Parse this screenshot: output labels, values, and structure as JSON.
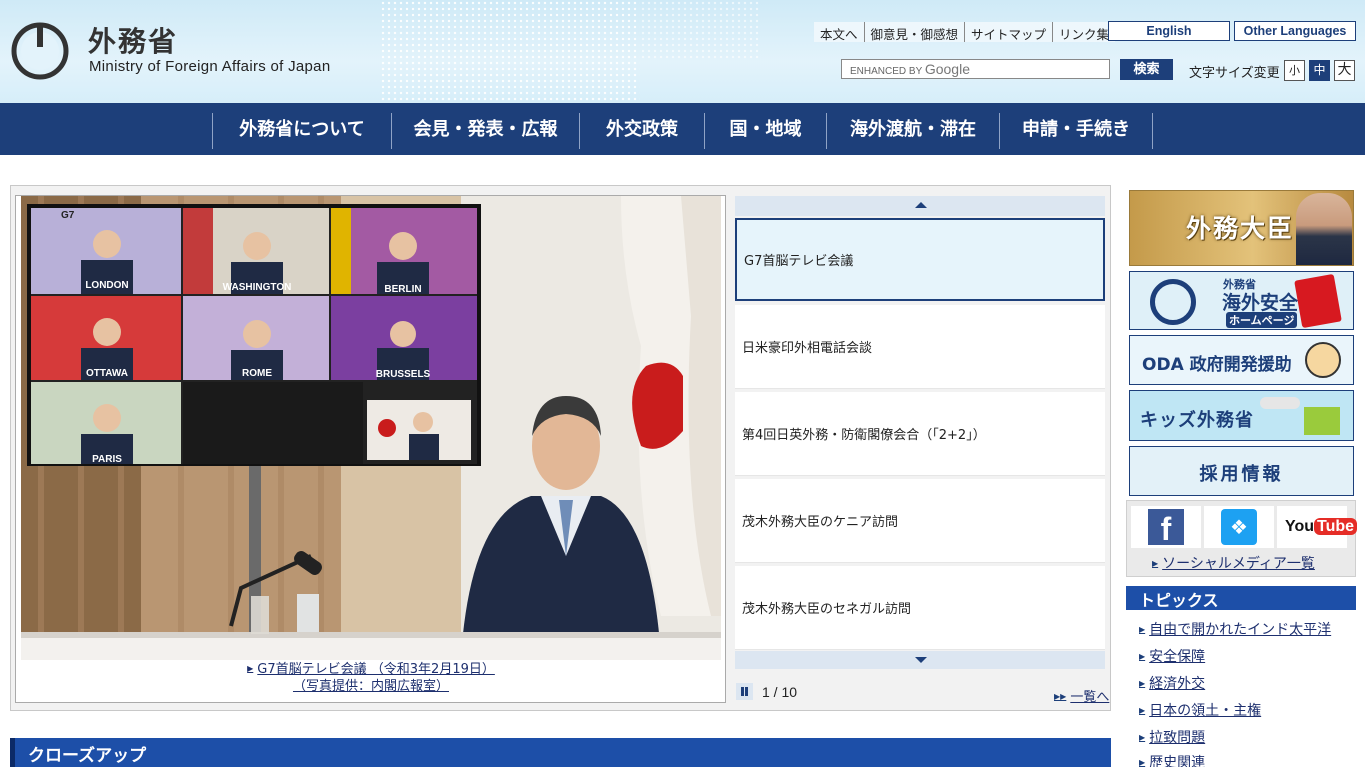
{
  "header": {
    "title_ja": "外務省",
    "title_en": "Ministry of Foreign Affairs of Japan",
    "util_links": [
      "本文へ",
      "御意見・御感想",
      "サイトマップ",
      "リンク集"
    ],
    "english_label": "English",
    "other_languages_label": "Other Languages",
    "search": {
      "enhanced_by": "ENHANCED BY",
      "google": "Google",
      "button": "検索"
    },
    "font_size": {
      "label": "文字サイズ変更",
      "small": "小",
      "medium": "中",
      "large": "大"
    }
  },
  "nav": {
    "items": [
      "外務省について",
      "会見・発表・広報",
      "外交政策",
      "国・地域",
      "海外渡航・滞在",
      "申請・手続き"
    ]
  },
  "slider": {
    "photo_labels": [
      "G7",
      "LONDON",
      "WASHINGTON",
      "BERLIN",
      "OTTAWA",
      "ROME",
      "BRUSSELS",
      "PARIS"
    ],
    "caption_line1": "G7首脳テレビ会議 （令和3年2月19日）",
    "caption_line2": "（写真提供：内閣広報室）",
    "items": [
      "G7首脳テレビ会議",
      "日米豪印外相電話会談",
      "第4回日英外務・防衛閣僚会合（「2+2」）",
      "茂木外務大臣のケニア訪問",
      "茂木外務大臣のセネガル訪問"
    ],
    "counter": "1 / 10",
    "list_all": "一覧へ"
  },
  "closeup": {
    "title": "クローズアップ"
  },
  "sidebar": {
    "minister": "外務大臣",
    "safety_small": "外務省",
    "safety_big": "海外安全",
    "safety_hp": "ホームページ",
    "oda": "ODA 政府開発援助",
    "kids": "キッズ外務省",
    "recruit": "採用情報",
    "social_link": "ソーシャルメディア一覧",
    "topics_title": "トピックス",
    "topics": [
      "自由で開かれたインド太平洋",
      "安全保障",
      "経済外交",
      "日本の領土・主権",
      "拉致問題",
      "歴史関連"
    ]
  },
  "colors": {
    "navy": "#1d3f7a",
    "blue_bar": "#1d4fa8",
    "header_bg": "#cfeaf7"
  }
}
